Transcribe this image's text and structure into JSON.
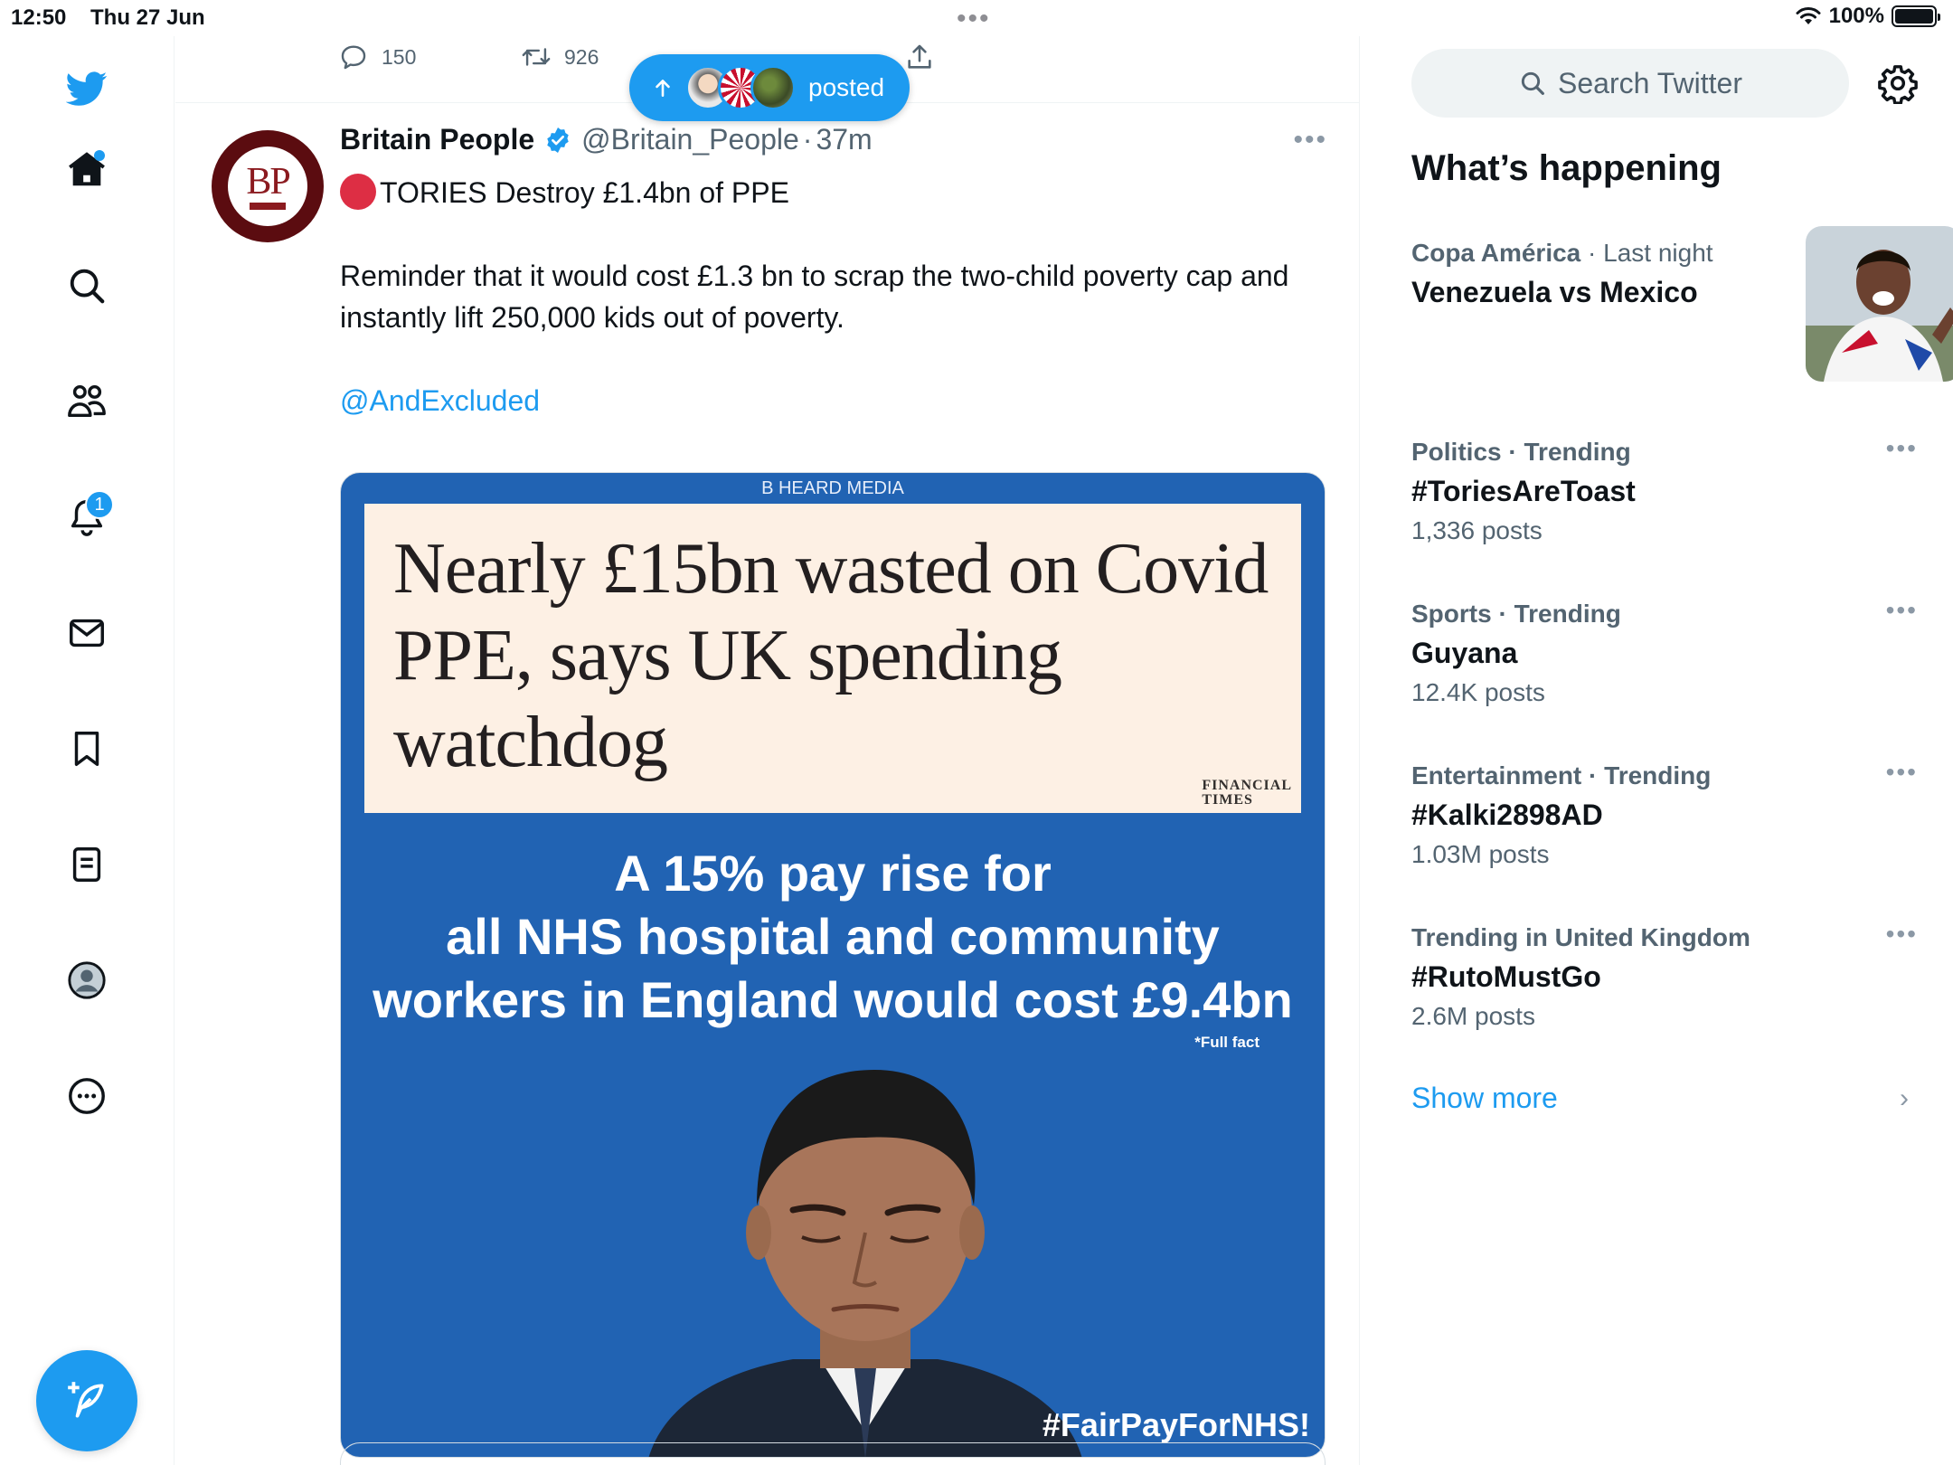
{
  "status_bar": {
    "time": "12:50",
    "date": "Thu 27 Jun",
    "battery": "100%"
  },
  "nav": {
    "notification_count": "1",
    "icons": [
      "twitter-bird-icon",
      "home-icon",
      "search-icon",
      "communities-icon",
      "notifications-icon",
      "messages-icon",
      "bookmarks-icon",
      "lists-icon",
      "profile-icon",
      "more-icon"
    ]
  },
  "prev_tweet_actions": {
    "replies": "150",
    "retweets": "926"
  },
  "posted_pill": {
    "label": "posted"
  },
  "tweet": {
    "author_name": "Britain People",
    "handle": "@Britain_People",
    "separator": "·",
    "time_ago": "37m",
    "avatar_text": "BP",
    "line1": "TORIES Destroy £1.4bn of PPE",
    "line2": "Reminder that it would cost £1.3 bn to scrap the two-child poverty cap and instantly lift 250,000 kids out of poverty.",
    "mention": "@AndExcluded",
    "image": {
      "source": "B HEARD MEDIA",
      "headline": "Nearly £15bn wasted on Covid PPE, says UK spending watchdog",
      "ft_logo_line1": "FINANCIAL",
      "ft_logo_line2": "TIMES",
      "pay_line1": "A 15% pay rise for",
      "pay_line2": "all NHS hospital and community",
      "pay_line3": "workers in England would cost £9.4bn",
      "full_fact": "*Full fact",
      "hashtag": "#FairPayForNHS!"
    }
  },
  "sidebar": {
    "search_placeholder": "Search Twitter",
    "section_title": "What’s happening",
    "featured": {
      "category": "Copa América",
      "time": "Last night",
      "title": "Venezuela vs Mexico"
    },
    "trends": [
      {
        "category": "Politics",
        "status": "Trending",
        "name": "#ToriesAreToast",
        "count": "1,336 posts"
      },
      {
        "category": "Sports",
        "status": "Trending",
        "name": "Guyana",
        "count": "12.4K posts"
      },
      {
        "category": "Entertainment",
        "status": "Trending",
        "name": "#Kalki2898AD",
        "count": "1.03M posts"
      },
      {
        "category": "Trending in United Kingdom",
        "status": "",
        "name": "#RutoMustGo",
        "count": "2.6M posts"
      }
    ],
    "show_more": "Show more"
  },
  "colors": {
    "accent": "#1d9bf0",
    "image_blue": "#2163b3",
    "ft_pink": "#fdf0e4",
    "bp_red": "#8b1a1f"
  }
}
